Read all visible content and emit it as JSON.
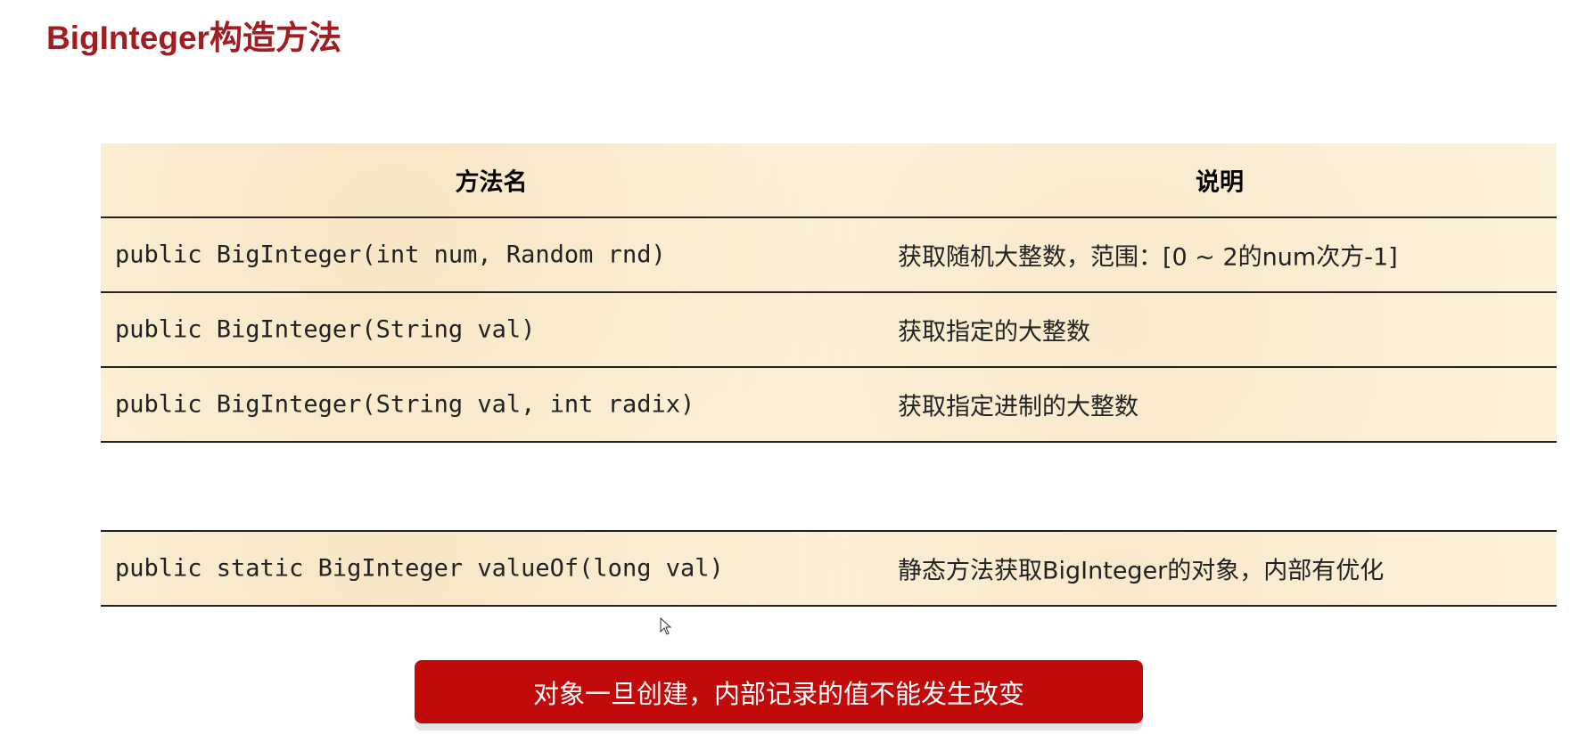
{
  "title": "BigInteger构造方法",
  "table": {
    "headers": [
      "方法名",
      "说明"
    ],
    "rows": [
      {
        "method": "public BigInteger(int num, Random rnd)",
        "desc": "获取随机大整数，范围：[0 ~ 2的num次方-1]"
      },
      {
        "method": "public BigInteger(String val)",
        "desc": "获取指定的大整数"
      },
      {
        "method": "public BigInteger(String val, int radix)",
        "desc": "获取指定进制的大整数"
      }
    ]
  },
  "table2": {
    "rows": [
      {
        "method": "public static BigInteger valueOf(long val)",
        "desc": "静态方法获取BigInteger的对象，内部有优化"
      }
    ]
  },
  "note": "对象一旦创建，内部记录的值不能发生改变"
}
